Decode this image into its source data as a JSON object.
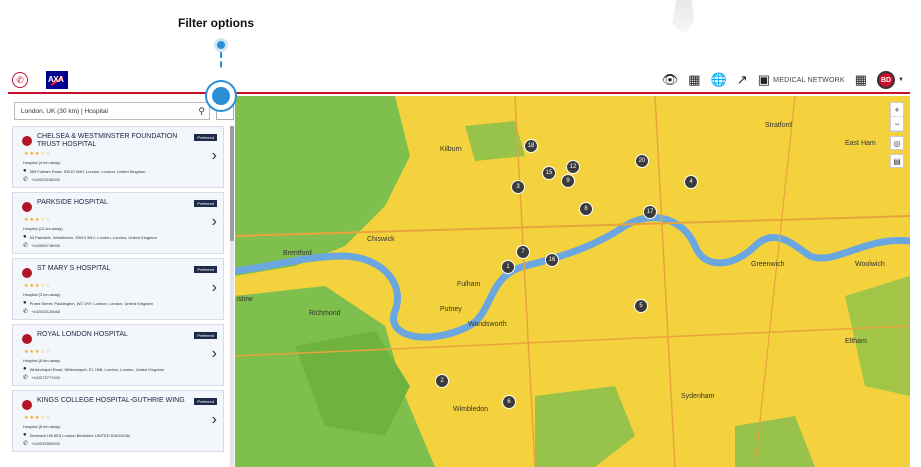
{
  "annotation": {
    "label": "Filter options"
  },
  "header": {
    "medical_network": "MEDICAL NETWORK",
    "avatar": "BD",
    "logo_text": "AXA"
  },
  "search": {
    "value": "London, UK (30 km) | Hospital"
  },
  "badge_label": "Preferred",
  "hospitals": [
    {
      "name": "CHELSEA & WESTMINSTER FOUNDATION TRUST HOSPITAL",
      "distance": "Hospital (4 km away)",
      "address": "369 Fulham Road, SW10 9NH, London, London, United Kingdom",
      "phone": "+442033155000"
    },
    {
      "name": "PARKSIDE HOSPITAL",
      "distance": "Hospital (12 km away)",
      "address": "53 Parkside, Wimbledon, SW19 5NX, London, London, United Kingdom",
      "phone": "+442089718000"
    },
    {
      "name": "ST MARY S HOSPITAL",
      "distance": "Hospital (3 km away)",
      "address": "Praed Street, Paddington, W2 1NY, London, London, United Kingdom",
      "phone": "+442033126666"
    },
    {
      "name": "ROYAL LONDON HOSPITAL",
      "distance": "Hospital (8 km away)",
      "address": "Whitechapel Road, Whitechapel, E1 1BB, London, London, United Kingdom",
      "phone": "+442073777000"
    },
    {
      "name": "KINGS COLLEGE HOSPITAL-GUTHRIE WING",
      "distance": "Hospital (8 km away)",
      "address": "Denmark Hill,SE5 London Berkshire UNITED KINGDOM",
      "phone": "+442032993000"
    }
  ],
  "map": {
    "places": [
      "Kilburn",
      "Stratford",
      "East Ham",
      "Brentford",
      "Chiswick",
      "Fulham",
      "Greenwich",
      "Woolwich",
      "Richmond",
      "Putney",
      "Wandsworth",
      "Eltham",
      "Sydenham",
      "Wimbledon",
      "islow"
    ],
    "markers": [
      "18",
      "15",
      "12",
      "20",
      "3",
      "9",
      "4",
      "8",
      "17",
      "7",
      "1",
      "16",
      "5",
      "2",
      "6"
    ]
  },
  "colors": {
    "accent": "#c8102e",
    "callout": "#2b8fd6",
    "map_yellow": "#f4d23e",
    "park_green": "#7fbf4d",
    "river": "#6aa7e0"
  }
}
